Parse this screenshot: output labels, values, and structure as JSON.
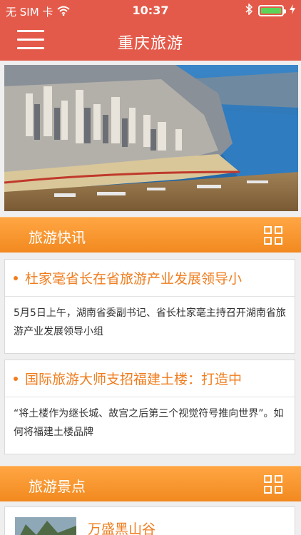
{
  "status_bar": {
    "carrier": "无 SIM 卡",
    "time": "10:37",
    "icons": [
      "wifi-icon",
      "bluetooth-icon",
      "battery-charging-icon"
    ],
    "battery_level": 1.0
  },
  "navbar": {
    "title": "重庆旅游",
    "menu_icon": "hamburger-icon"
  },
  "hero": {
    "image": "aerial-city-river-photo"
  },
  "news_section": {
    "title": "旅游快讯",
    "icon": "grid-icon",
    "items": [
      {
        "title": "杜家毫省长在省旅游产业发展领导小",
        "summary": "5月5日上午，湖南省委副书记、省长杜家毫主持召开湖南省旅游产业发展领导小组"
      },
      {
        "title": "国际旅游大师支招福建土楼：打造中",
        "summary": "“将土楼作为继长城、故宫之后第三个视觉符号推向世界”。如何将福建土楼品牌"
      }
    ]
  },
  "scenic_section": {
    "title": "旅游景点",
    "icon": "grid-icon",
    "items": [
      {
        "name": "万盛黑山谷",
        "thumbnail": "mountain-photo"
      }
    ]
  },
  "colors": {
    "primary_red": "#e45a4a",
    "accent_orange": "#f2891f",
    "title_orange": "#f07d1e"
  }
}
